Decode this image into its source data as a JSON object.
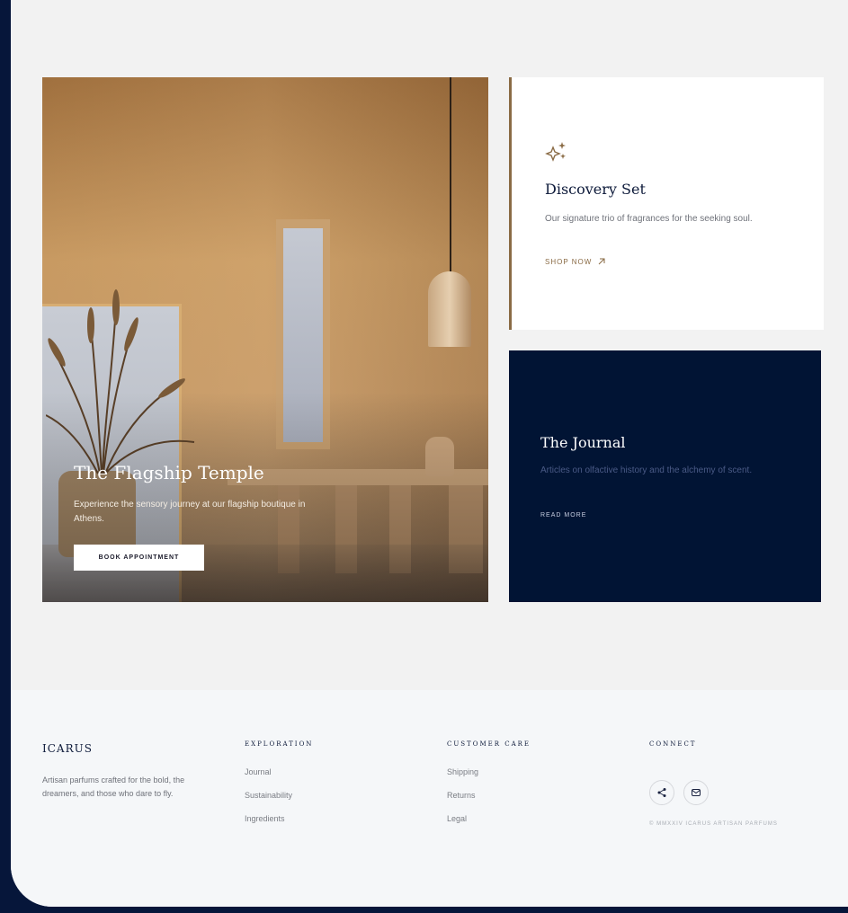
{
  "hero": {
    "title": "The Flagship Temple",
    "description": "Experience the sensory journey at our flagship boutique in Athens.",
    "button_label": "BOOK APPOINTMENT"
  },
  "discovery_card": {
    "icon": "sparkle-icon",
    "title": "Discovery Set",
    "description": "Our signature trio of fragrances for the seeking soul.",
    "link_label": "SHOP NOW",
    "link_icon": "arrow-up-right-icon",
    "accent_color": "#8a6b45"
  },
  "journal_card": {
    "title": "The Journal",
    "description": "Articles on olfactive history and the alchemy of scent.",
    "link_label": "READ MORE",
    "background_color": "#011434"
  },
  "footer": {
    "brand": "ICARUS",
    "tagline": "Artisan parfums crafted for the bold, the dreamers, and those who dare to fly.",
    "exploration": {
      "heading": "EXPLORATION",
      "links": [
        "Journal",
        "Sustainability",
        "Ingredients"
      ]
    },
    "customer_care": {
      "heading": "CUSTOMER CARE",
      "links": [
        "Shipping",
        "Returns",
        "Legal"
      ]
    },
    "connect": {
      "heading": "CONNECT",
      "icons": [
        "share-icon",
        "mail-icon"
      ],
      "copyright": "© MMXXIV ICARUS ARTISAN PARFUMS"
    }
  }
}
